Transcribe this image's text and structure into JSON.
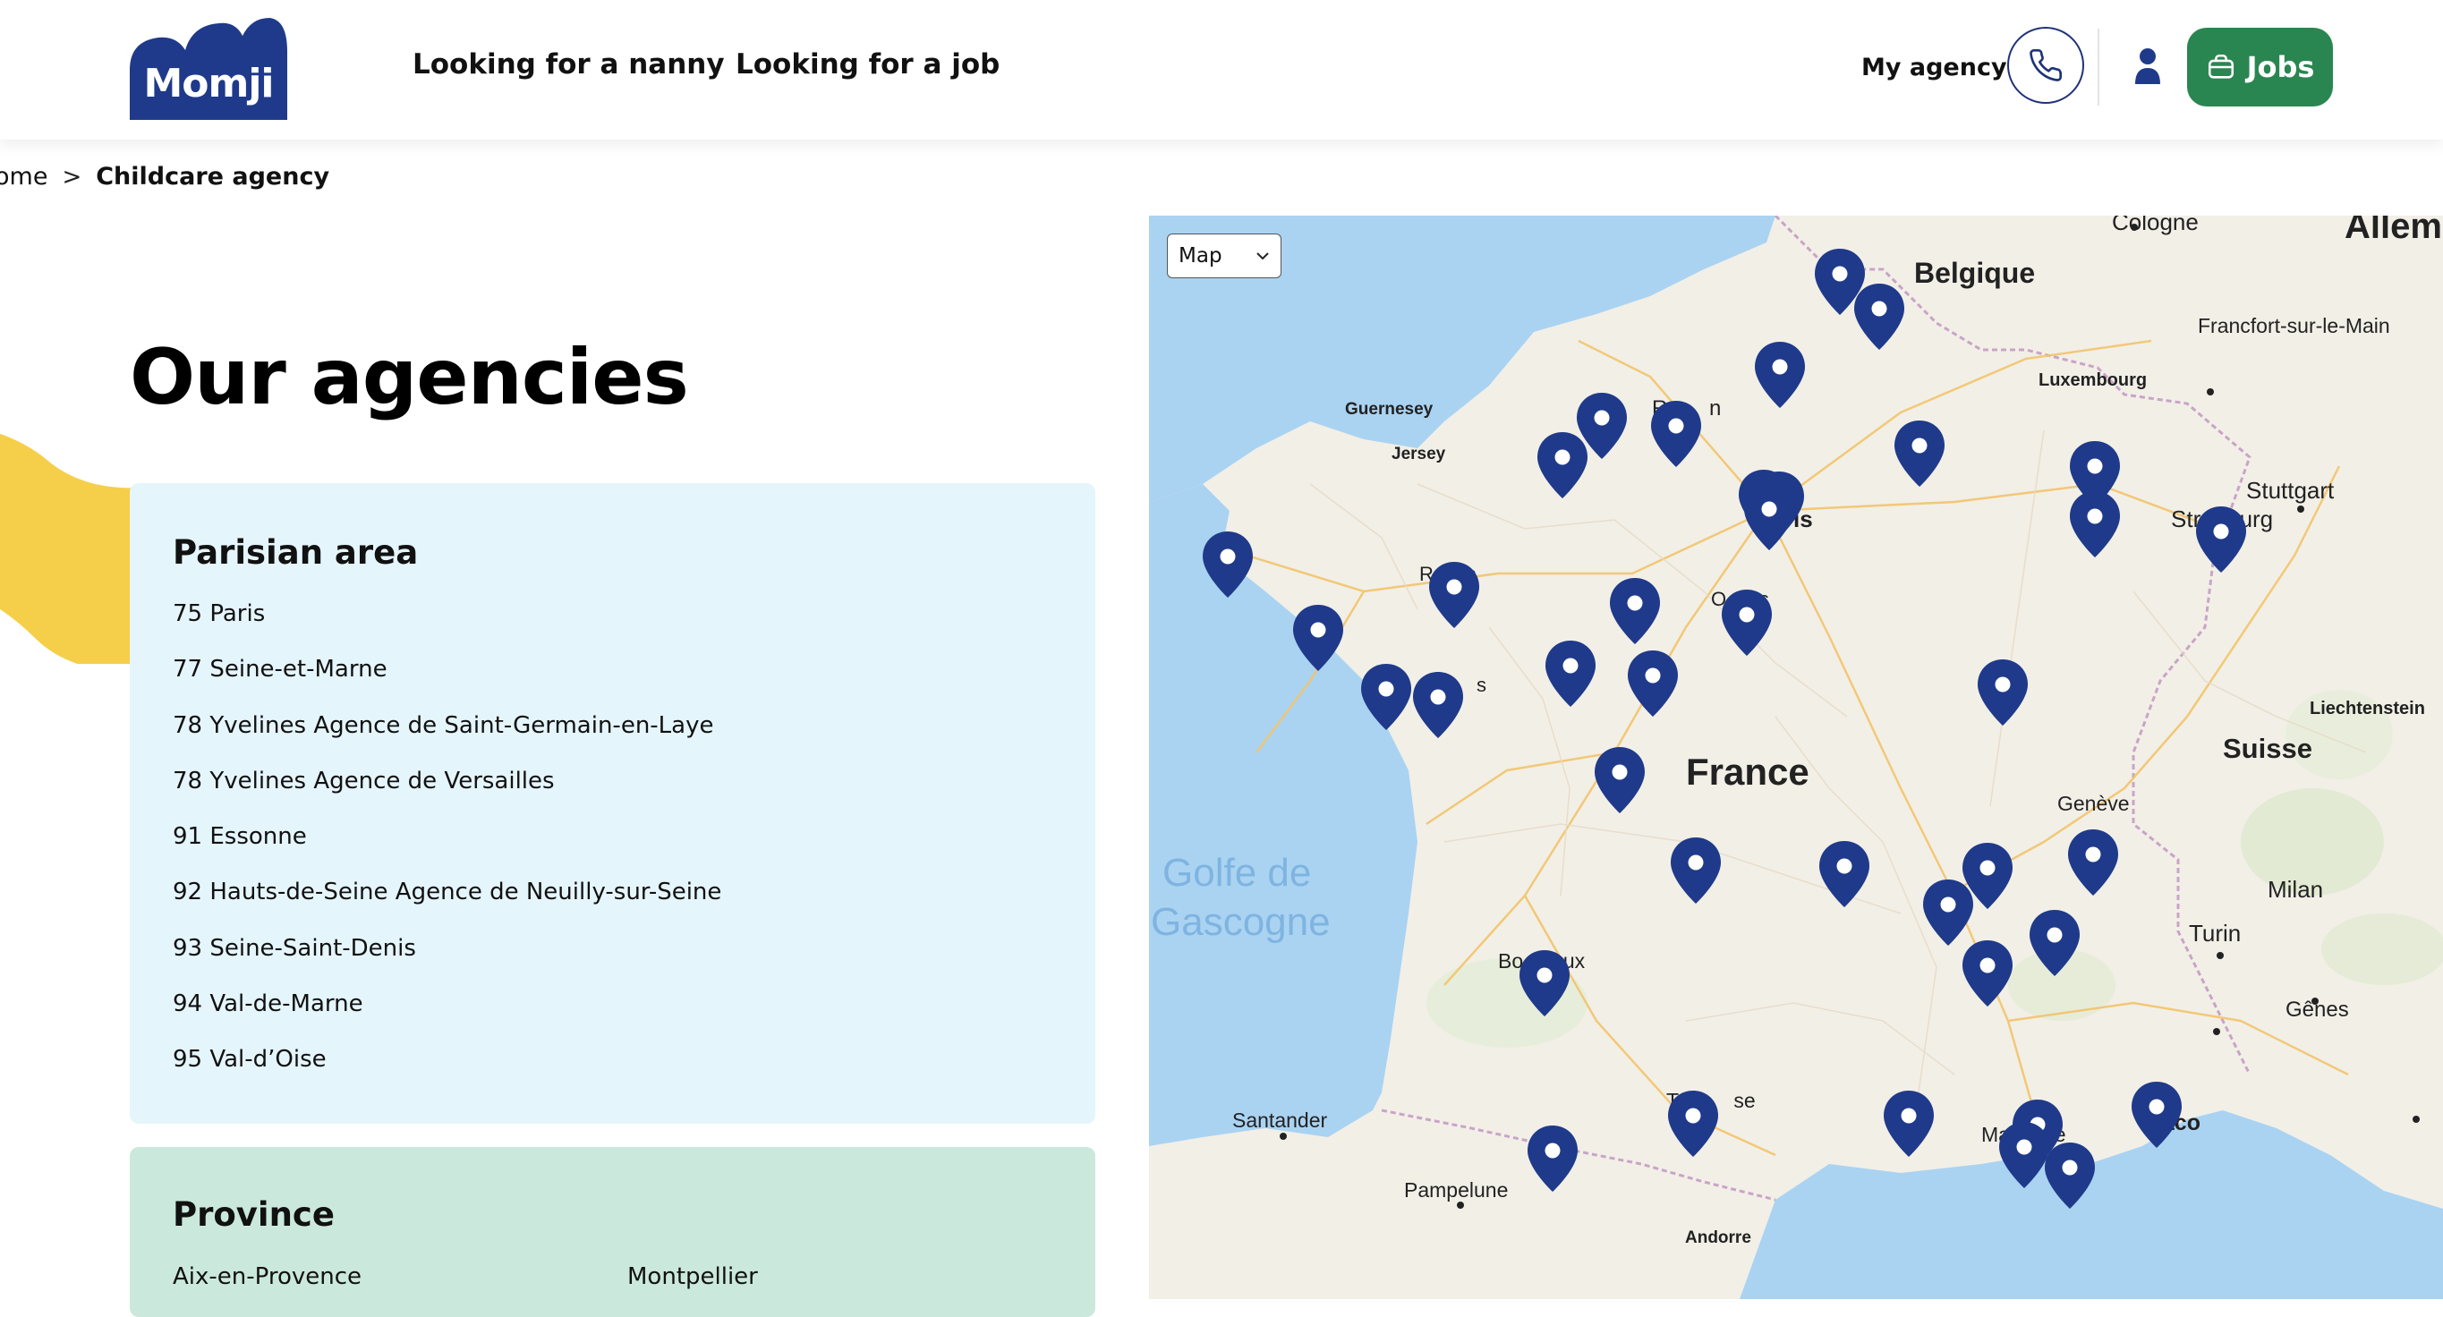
{
  "header": {
    "logo_text": "Momji",
    "nav": [
      "Looking for a nanny",
      "Looking for a job"
    ],
    "my_agency": "My agency",
    "jobs_label": "Jobs"
  },
  "breadcrumb": {
    "home": "ome",
    "separator": ">",
    "current": "Childcare agency"
  },
  "page_title": "Our agencies",
  "parisian": {
    "heading": "Parisian area",
    "items": [
      "75 Paris",
      "77 Seine-et-Marne",
      "78 Yvelines Agence de Saint-Germain-en-Laye",
      "78 Yvelines Agence de Versailles",
      "91 Essonne",
      "92 Hauts-de-Seine Agence de Neuilly-sur-Seine",
      "93 Seine-Saint-Denis",
      "94 Val-de-Marne",
      "95 Val-d’Oise"
    ]
  },
  "province": {
    "heading": "Province",
    "items": [
      "Aix-en-Provence",
      "Montpellier"
    ]
  },
  "map": {
    "select_value": "Map",
    "labels": {
      "cologne": "Cologne",
      "allem": "Allem",
      "belgique": "Belgique",
      "francfort": "Francfort-sur-le-Main",
      "luxembourg": "Luxembourg",
      "guernesey": "Guernesey",
      "jersey": "Jersey",
      "stuttgart": "Stuttgart",
      "strasbourg": "Str      urg",
      "rouen": "R       n",
      "paris": "is",
      "rennes": "R      s",
      "orleans": "O      s",
      "nantes": "s",
      "liechtenstein": "Liechtenstein",
      "suisse": "Suisse",
      "geneve": "Genève",
      "france": "France",
      "golfe1": "Golfe de",
      "golfe2": "Gascogne",
      "milan": "Milan",
      "turin": "Turin",
      "bordeaux": "Bo       ux",
      "genes": "Gênes",
      "santander": "Santander",
      "toulouse": "To        se",
      "marseille": "Ma       le",
      "monaco": "  aco",
      "pampelune": "Pampelune",
      "andorre": "Andorre"
    }
  },
  "colors": {
    "brand_navy": "#1f3a8a",
    "jobs_green": "#2a8651",
    "panel_blue": "#e5f5fc",
    "panel_green": "#cae9dc",
    "accent_yellow": "#f6cf4a",
    "sea": "#aad3f2"
  }
}
